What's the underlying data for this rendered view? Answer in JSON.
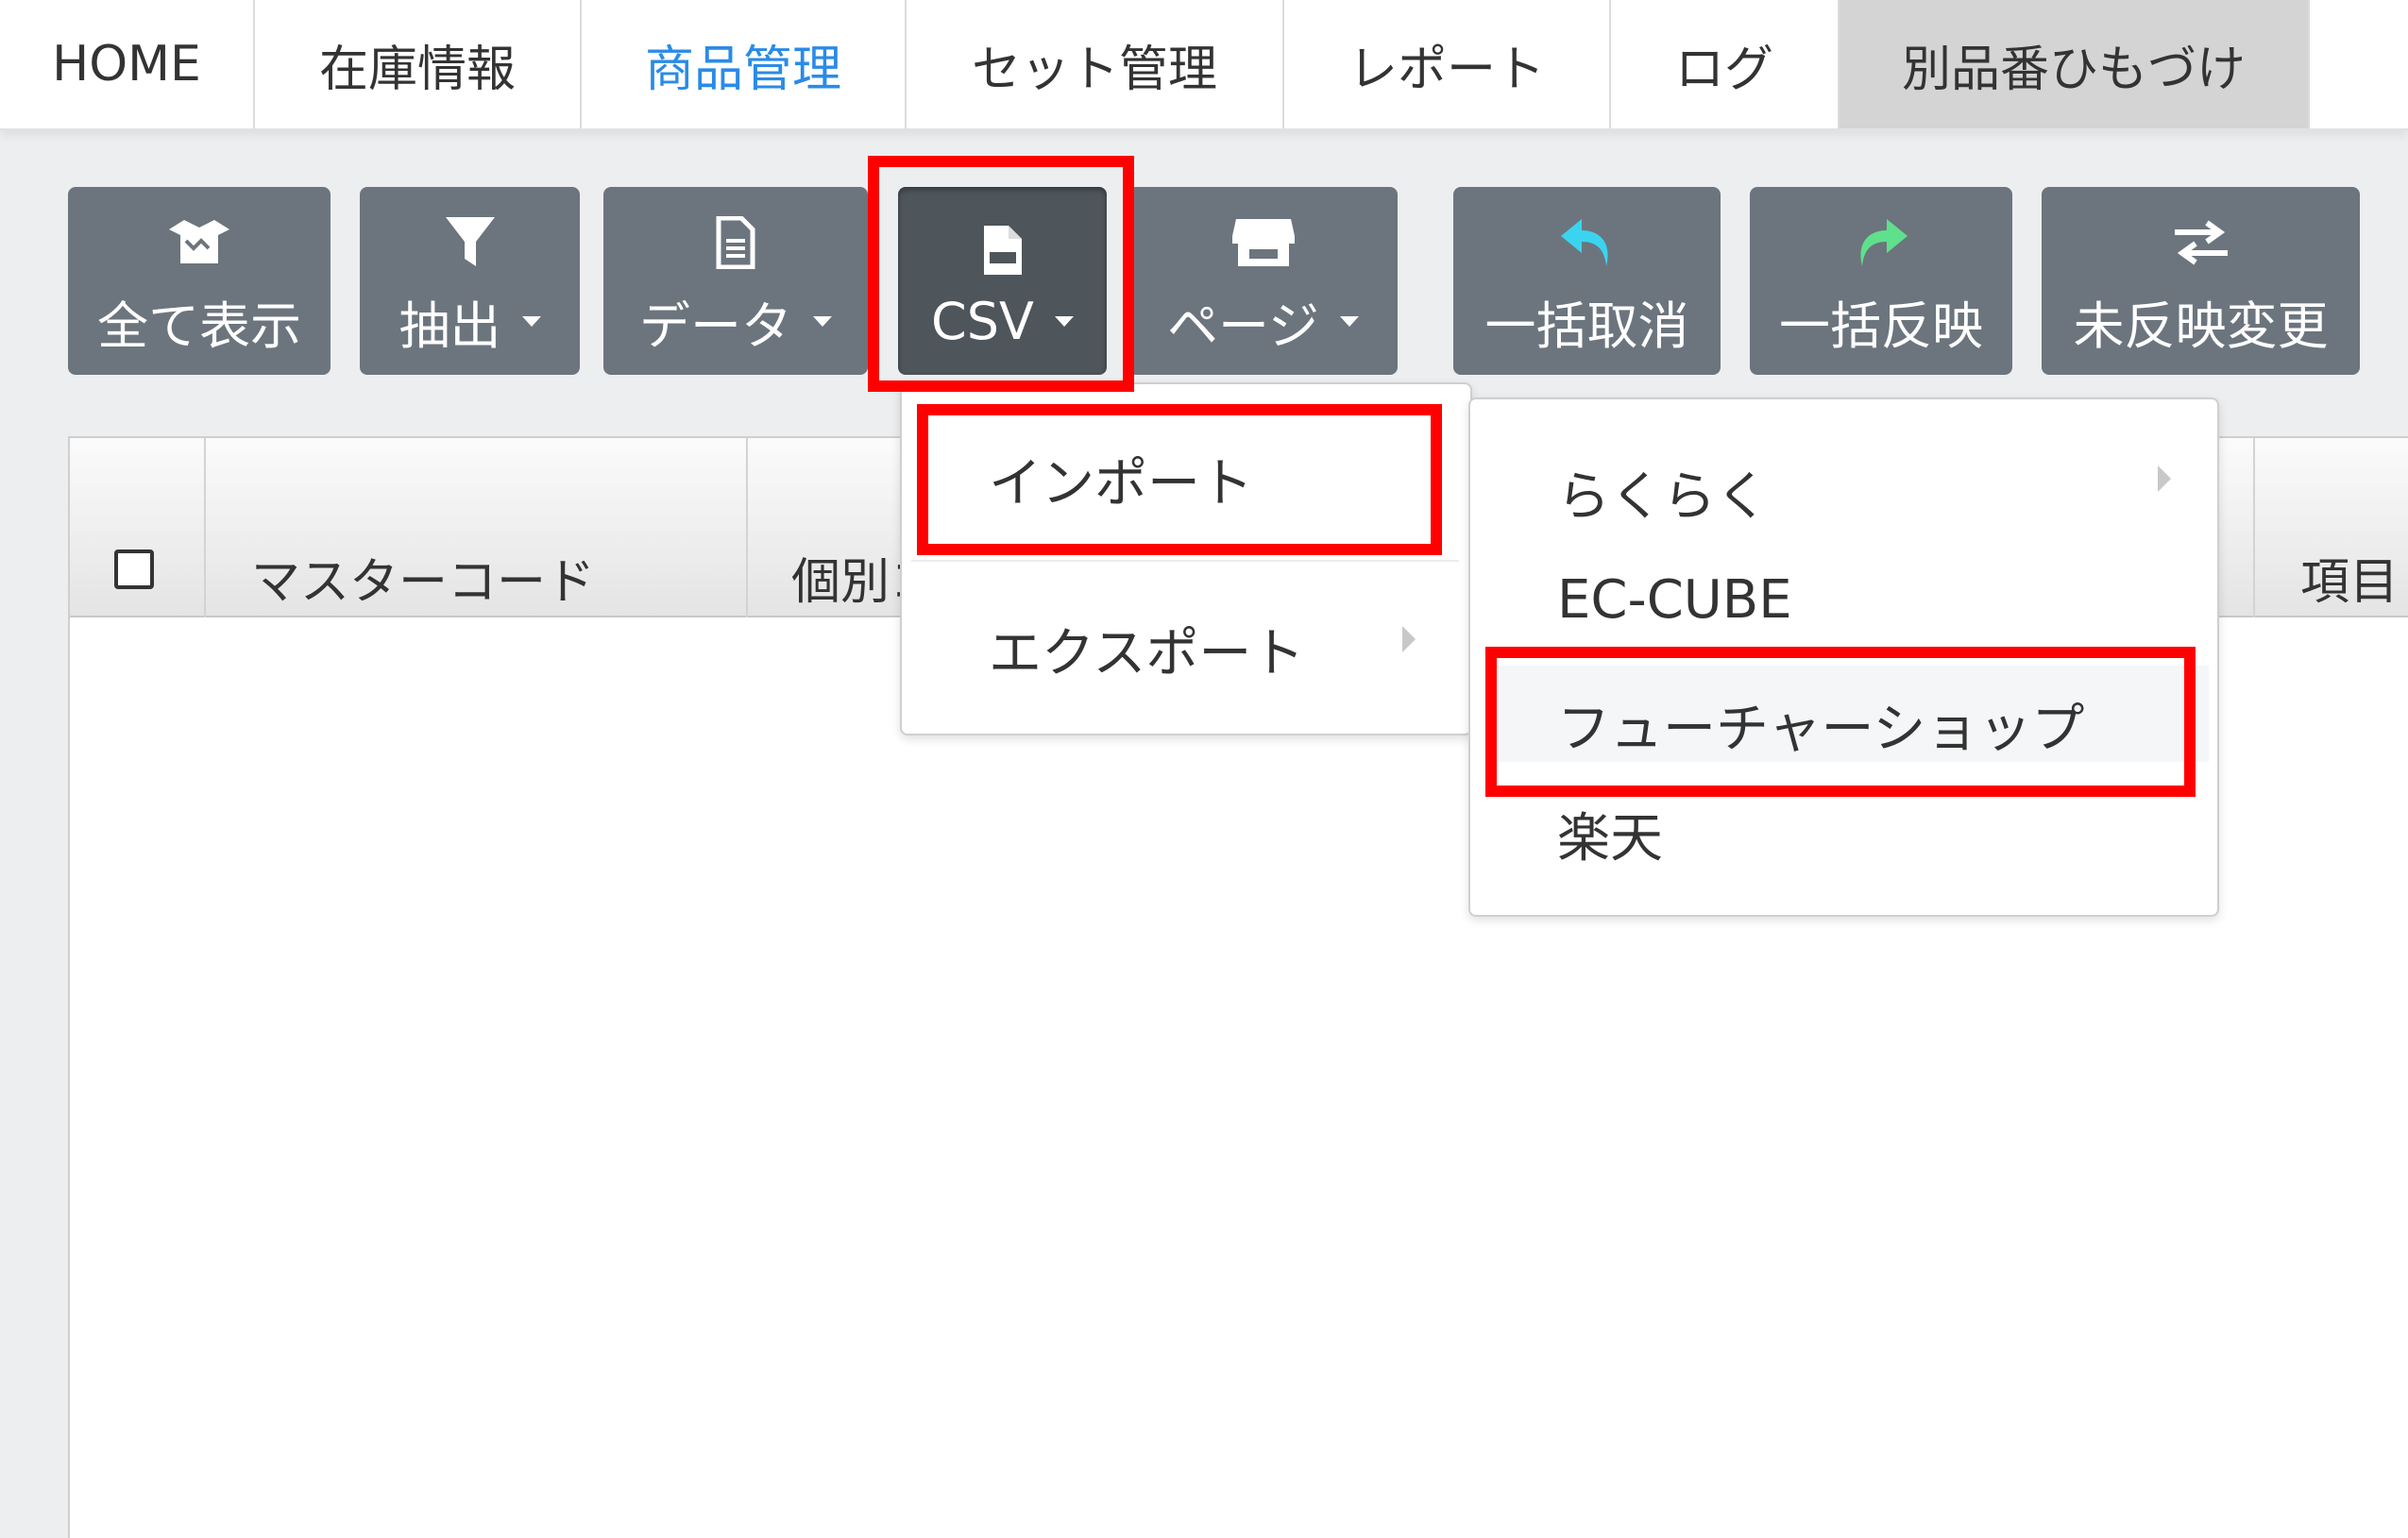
{
  "nav": {
    "tabs": [
      {
        "label": "HOME"
      },
      {
        "label": "在庫情報"
      },
      {
        "label": "商品管理"
      },
      {
        "label": "セット管理"
      },
      {
        "label": "レポート"
      },
      {
        "label": "ログ"
      },
      {
        "label": "別品番ひもづけ"
      }
    ],
    "active_color": "#2a8be6"
  },
  "toolbar": {
    "show_all": "全て表示",
    "filter": "抽出",
    "data": "データ",
    "csv": "CSV",
    "page": "ページ",
    "undo_all": "一括取消",
    "apply_all": "一括反映",
    "unapplied": "未反映変更",
    "button_color": "#6c757d"
  },
  "table": {
    "headers": [
      "マスターコード",
      "個別コ",
      "項目"
    ]
  },
  "csv_menu": {
    "import": "インポート",
    "export": "エクスポート"
  },
  "import_submenu": {
    "items": [
      "らくらく",
      "EC-CUBE",
      "フューチャーショップ",
      "楽天"
    ]
  },
  "icons": {
    "show_all": "box-open-icon",
    "filter": "filter-icon",
    "data": "file-icon",
    "csv": "csv-file-icon",
    "page": "store-icon",
    "undo_all": "undo-arrow-icon",
    "apply_all": "redo-arrow-icon",
    "unapplied": "exchange-icon"
  },
  "colors": {
    "highlight": "#ff0000",
    "undo_icon": "#3bd4f0",
    "apply_icon": "#5fe08c"
  }
}
